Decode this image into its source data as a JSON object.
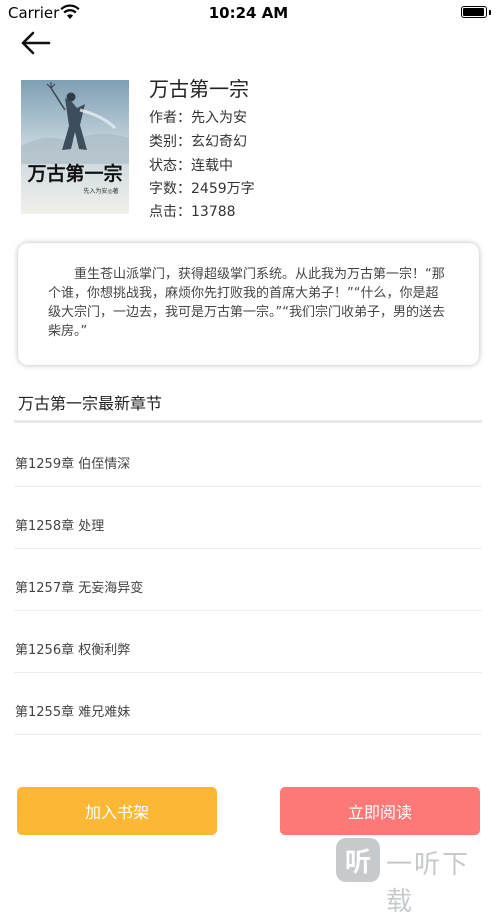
{
  "status_bar": {
    "carrier": "Carrier",
    "time": "10:24 AM",
    "battery_level": 0.95
  },
  "navigation": {
    "back_icon": "arrow-left-icon"
  },
  "book": {
    "cover_icon": "book-cover-image",
    "cover_title": "万古第一宗",
    "cover_author": "先入为安◎著",
    "title": "万古第一宗",
    "author": "作者：先入为安",
    "category": "类别：玄幻奇幻",
    "status": "状态：连载中",
    "word_count": "字数：2459万字",
    "clicks": "点击：13788",
    "intro": "重生苍山派掌门，获得超级掌门系统。从此我为万古第一宗！“那个谁，你想挑战我，麻烦你先打败我的首席大弟子！”“什么，你是超级大宗门，一边去，我可是万古第一宗。”“我们宗门收弟子，男的送去柴房。”"
  },
  "chapters": {
    "section_title": "万古第一宗最新章节",
    "items": [
      {
        "label": "第1259章 伯侄情深"
      },
      {
        "label": "第1258章  处理"
      },
      {
        "label": "第1257章 无妄海异变"
      },
      {
        "label": "第1256章 权衡利弊"
      },
      {
        "label": "第1255章 难兄难妹"
      }
    ]
  },
  "actions": {
    "add_shelf_label": "加入书架",
    "read_now_label": "立即阅读",
    "add_shelf_color": "#fbb735",
    "read_now_color": "#fd7978"
  },
  "watermark": {
    "logo_glyph": "听",
    "text": "一听下载"
  }
}
